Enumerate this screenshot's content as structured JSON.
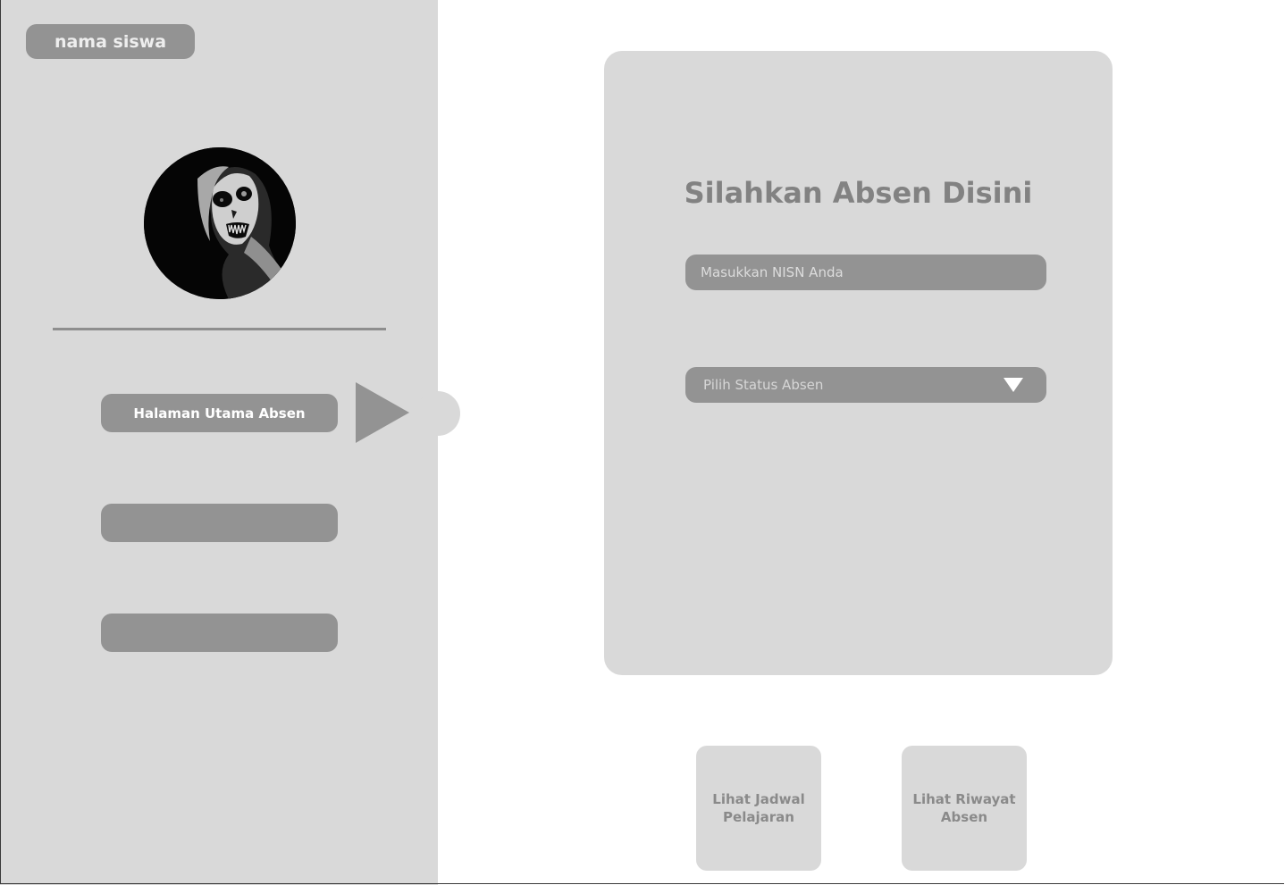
{
  "sidebar": {
    "student_name": "nama siswa",
    "nav": [
      {
        "label": "Halaman Utama Absen",
        "active": true
      },
      {
        "label": ""
      },
      {
        "label": ""
      }
    ]
  },
  "form": {
    "title": "Silahkan Absen Disini",
    "nisn_placeholder": "Masukkan NISN Anda",
    "status_placeholder": "Pilih Status Absen"
  },
  "actions": {
    "schedule_label": "Lihat Jadwal Pelajaran",
    "history_label": "Lihat Riwayat Absen"
  },
  "colors": {
    "panel": "#d9d9d9",
    "control": "#939393",
    "text_muted": "#828282"
  }
}
